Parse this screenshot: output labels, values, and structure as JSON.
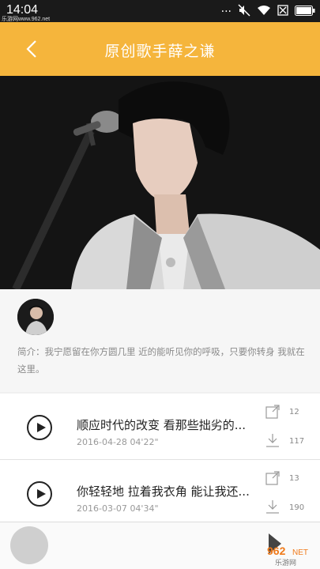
{
  "status": {
    "time": "14:04",
    "watermark": "乐游网www.962.net"
  },
  "header": {
    "title": "原创歌手薛之谦"
  },
  "profile": {
    "intro": "简介：我宁愿留在你方圆几里 近的能听见你的呼吸，只要你转身 我就在这里。"
  },
  "songs": [
    {
      "title": "顺应时代的改变 看那些拙劣的...",
      "date": "2016-04-28",
      "duration": "04'22\"",
      "shares": "12",
      "downloads": "117"
    },
    {
      "title": "你轻轻地 拉着我衣角  能让我还...",
      "date": "2016-03-07",
      "duration": "04'34\"",
      "shares": "13",
      "downloads": "190"
    }
  ],
  "watermark_logo": "962 NET 乐游网",
  "colors": {
    "header": "#f5b53c",
    "status_bar": "#1a1a1a"
  }
}
